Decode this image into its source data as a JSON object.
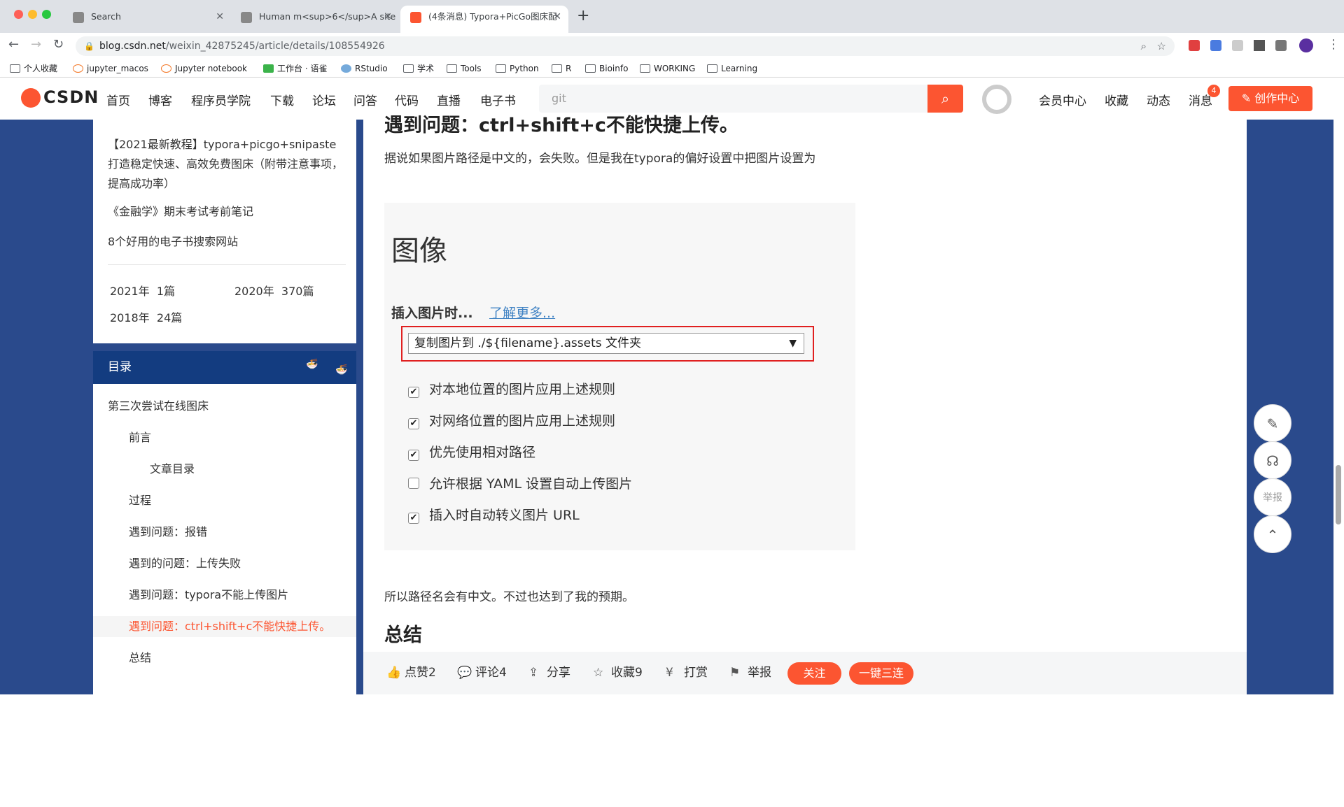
{
  "browser": {
    "tabs": [
      {
        "title": "Search",
        "active": false
      },
      {
        "title": "Human m<sup>6</sup>A site",
        "active": false
      },
      {
        "title": "(4条消息) Typora+PicGo图床配",
        "active": true
      }
    ],
    "new_tab_label": "+",
    "url_host": "blog.csdn.net",
    "url_path": "/weixin_42875245/article/details/108554926",
    "bookmarks": [
      "个人收藏",
      "jupyter_macos",
      "Jupyter notebook",
      "工作台 · 语雀",
      "RStudio",
      "学术",
      "Tools",
      "Python",
      "R",
      "Bioinfo",
      "WORKING",
      "Learning"
    ]
  },
  "csdn": {
    "logo_text": "CSDN",
    "nav": [
      "首页",
      "博客",
      "程序员学院",
      "下载",
      "论坛",
      "问答",
      "代码",
      "直播",
      "电子书"
    ],
    "search_placeholder": "git",
    "right_nav": [
      "会员中心",
      "收藏",
      "动态",
      "消息"
    ],
    "msg_count": "4",
    "create_label": "创作中心"
  },
  "sidebar": {
    "recommended": [
      "【2021最新教程】typora+picgo+snipaste打造稳定快速、高效免费图床（附带注意事项，提高成功率）",
      "《金融学》期末考试考前笔记",
      "8个好用的电子书搜索网站"
    ],
    "archive": [
      {
        "year": "2021年",
        "count": "1篇"
      },
      {
        "year": "2020年",
        "count": "370篇"
      },
      {
        "year": "2018年",
        "count": "24篇"
      }
    ],
    "toc_title": "目录",
    "toc": [
      {
        "label": "第三次尝试在线图床",
        "level": 1
      },
      {
        "label": "前言",
        "level": 2
      },
      {
        "label": "文章目录",
        "level": 3
      },
      {
        "label": "过程",
        "level": 2
      },
      {
        "label": "遇到问题：报错",
        "level": 2
      },
      {
        "label": "遇到的问题：上传失败",
        "level": 2
      },
      {
        "label": "遇到问题：typora不能上传图片",
        "level": 2
      },
      {
        "label": "遇到问题：ctrl+shift+c不能快捷上传。",
        "level": 2,
        "active": true
      },
      {
        "label": "总结",
        "level": 2
      }
    ]
  },
  "article": {
    "partial_heading": "遇到问题：ctrl+shift+c不能快捷上传。",
    "para1": "据说如果图片路径是中文的，会失败。但是我在typora的偏好设置中把图片设置为",
    "screenshot": {
      "title": "图像",
      "insert_label": "插入图片时...",
      "learn_more": "了解更多...",
      "select_value": "复制图片到 ./${filename}.assets 文件夹",
      "checkboxes": [
        {
          "label": "对本地位置的图片应用上述规则",
          "checked": true
        },
        {
          "label": "对网络位置的图片应用上述规则",
          "checked": true
        },
        {
          "label": "优先使用相对路径",
          "checked": true
        },
        {
          "label": "允许根据 YAML 设置自动上传图片",
          "checked": false
        },
        {
          "label": "插入时自动转义图片 URL",
          "checked": true
        }
      ]
    },
    "para2": "所以路径名会有中文。不过也达到了我的预期。",
    "heading2": "总结"
  },
  "bottom_bar": {
    "like": "点赞2",
    "comment": "评论4",
    "share": "分享",
    "collect": "收藏9",
    "reward": "打赏",
    "report": "举报",
    "follow": "关注",
    "triple": "一键三连"
  },
  "floating": {
    "report": "举报"
  }
}
